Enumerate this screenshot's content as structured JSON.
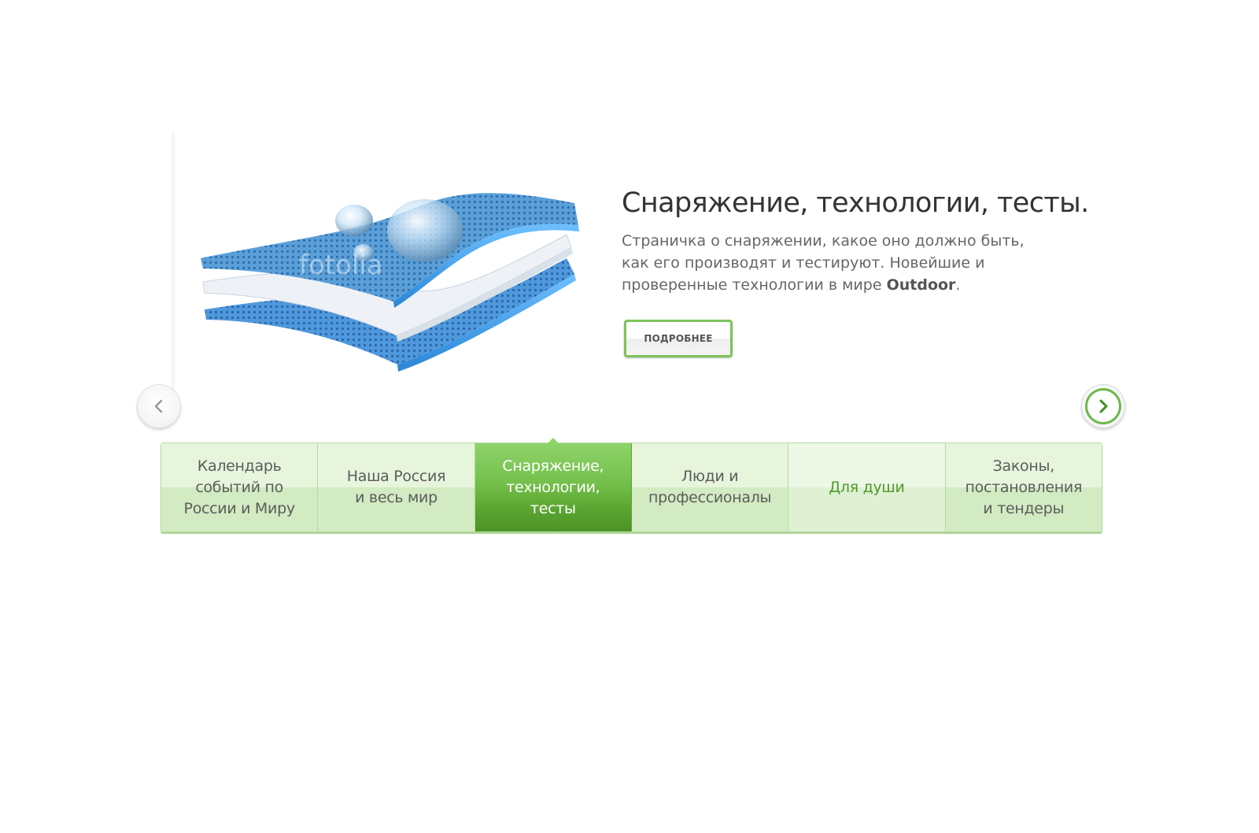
{
  "slider": {
    "title": "Снаряжение, технологии, тесты.",
    "description_main": "Страничка о снаряжении, какое оно должно быть, как его производят и тестируют. Новейшие и проверенные технологии в мире ",
    "description_bold": "Outdoor",
    "description_end": ".",
    "more_button_label": "ПОДРОБНЕЕ",
    "watermark": "fotolia",
    "prev_icon": "chevron-left-icon",
    "next_icon": "chevron-right-icon"
  },
  "categories": [
    {
      "label_lines": [
        "Календарь",
        "событий по",
        "России и Миру"
      ]
    },
    {
      "label_lines": [
        "Наша Россия",
        "и весь мир"
      ]
    },
    {
      "label_lines": [
        "Снаряжение,",
        "технологии, тесты"
      ],
      "state": "active"
    },
    {
      "label_lines": [
        "Люди и",
        "профессионалы"
      ]
    },
    {
      "label_lines": [
        "Для души"
      ],
      "state": "highlight"
    },
    {
      "label_lines": [
        "Законы,",
        "постановления",
        "и тендеры"
      ]
    }
  ],
  "colors": {
    "accent_green": "#74c04b",
    "active_tab_bottom": "#4d9227",
    "tab_light": "#e6f5dc",
    "tab_dark": "#d2ebc2",
    "highlight_text": "#4f9a2a",
    "fabric_blue": "#3a8fd6"
  }
}
